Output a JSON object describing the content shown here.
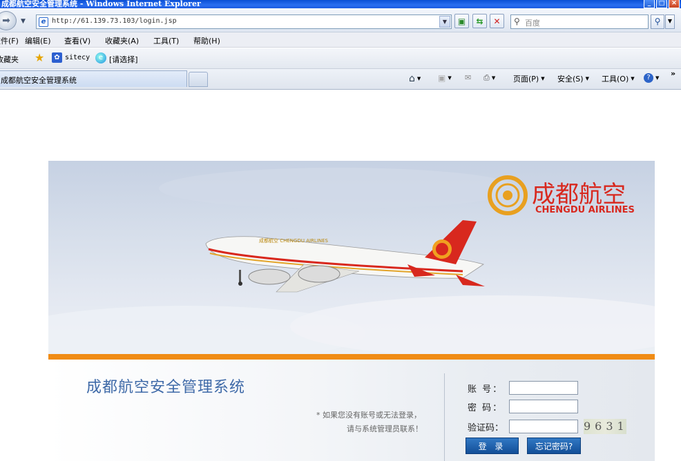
{
  "window": {
    "title": "成都航空安全管理系统 - Windows Internet Explorer"
  },
  "address": {
    "url": "http://61.139.73.103/login.jsp",
    "search_placeholder": "百度"
  },
  "menu": [
    "文件(F)",
    "编辑(E)",
    "查看(V)",
    "收藏夹(A)",
    "工具(T)",
    "帮助(H)"
  ],
  "favorites": {
    "label": "收藏夹",
    "links": [
      "sitecy",
      "[请选择]"
    ]
  },
  "tab": {
    "title": "成都航空安全管理系统"
  },
  "commands": {
    "page": "页面(P)",
    "safety": "安全(S)",
    "tools": "工具(O)"
  },
  "brand": {
    "cn": "成都航空",
    "en": "CHENGDU AIRLINES",
    "plane_livery": "成都航空 CHENGDU AIRLINES"
  },
  "login": {
    "system_title": "成都航空安全管理系统",
    "note_line1": "* 如果您没有账号或无法登录，",
    "note_line2": "请与系统管理员联系！",
    "account_label": "账  号：",
    "password_label": "密  码：",
    "captcha_label": "验证码：",
    "captcha_code": "9631",
    "login_button": "登  录",
    "forgot_button": "忘记密码?"
  },
  "colors": {
    "accent_orange": "#f08c15",
    "brand_red": "#d8281e",
    "title_blue": "#3f6aa8"
  }
}
